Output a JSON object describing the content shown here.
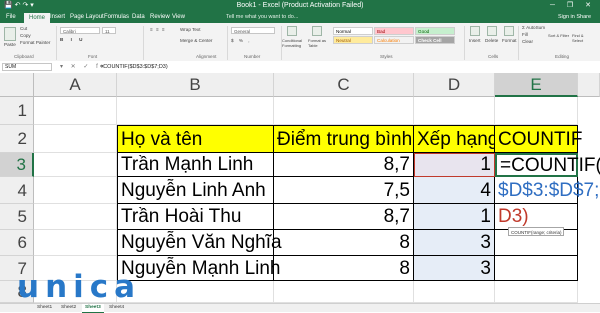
{
  "window": {
    "title": "Book1 - Excel (Product Activation Failed)",
    "controls": "─ ❐ ✕"
  },
  "quick_access": "💾 ↶ ↷ ▾",
  "tabs": [
    "File",
    "Home",
    "Insert",
    "Page Layout",
    "Formulas",
    "Data",
    "Review",
    "View"
  ],
  "active_tab": "Home",
  "tell_me": "Tell me what you want to do...",
  "sign_in": "Sign in  Share",
  "ribbon": {
    "clipboard": {
      "paste": "Paste",
      "cut": "Cut",
      "copy": "Copy",
      "format_painter": "Format Painter",
      "label": "Clipboard"
    },
    "font": {
      "name": "Calibri",
      "size": "11",
      "label": "Font"
    },
    "alignment": {
      "wrap": "Wrap Text",
      "merge": "Merge & Center",
      "label": "Alignment"
    },
    "number": {
      "format": "General",
      "label": "Number"
    },
    "styles": {
      "conditional": "Conditional Formatting",
      "format_table": "Format as Table",
      "normal": "Normal",
      "bad": "Bad",
      "good": "Good",
      "neutral": "Neutral",
      "calculation": "Calculation",
      "check_cell": "Check Cell",
      "label": "Styles"
    },
    "cells": {
      "insert": "Insert",
      "delete": "Delete",
      "format": "Format",
      "label": "Cells"
    },
    "editing": {
      "autosum": "AutoSum",
      "fill": "Fill",
      "clear": "Clear",
      "sort": "Sort & Filter",
      "find": "Find & Select",
      "label": "Editing"
    }
  },
  "formula_bar": {
    "name_box": "SUM",
    "buttons": "▾ ✕ ✓ fx",
    "formula": "=COUNTIF($D$3:$D$7;D3)"
  },
  "columns": [
    "A",
    "B",
    "C",
    "D",
    "E"
  ],
  "rows": [
    "1",
    "2",
    "3",
    "4",
    "5",
    "6",
    "7",
    "8"
  ],
  "cells": {
    "B2": "Họ và tên",
    "C2": "Điểm trung bình",
    "D2": "Xếp hạng",
    "E2": "COUNTIF",
    "B3": "Trần Mạnh Linh",
    "C3": "8,7",
    "D3": "1",
    "E3": "=COUNTIF(",
    "B4": "Nguyễn Linh Anh",
    "C4": "7,5",
    "D4": "4",
    "E4": "$D$3:$D$7;",
    "B5": "Trần Hoài Thu",
    "C5": "8,7",
    "D5": "1",
    "E5": "D3)",
    "B6": "Nguyễn Văn Nghĩa",
    "C6": "8",
    "D6": "3",
    "B7": "Nguyễn Mạnh Linh",
    "C7": "8",
    "D7": "3"
  },
  "tooltip": "COUNTIF(range; criteria)",
  "sheets": [
    "Sheet1",
    "Sheet2",
    "Sheet3",
    "Sheet4"
  ],
  "active_sheet": "Sheet3",
  "logo": "unica",
  "colors": {
    "excel_green": "#217346",
    "header_yellow": "#ffff00",
    "ref_blue": "#2f6ec2",
    "ref_red": "#c0392b"
  }
}
